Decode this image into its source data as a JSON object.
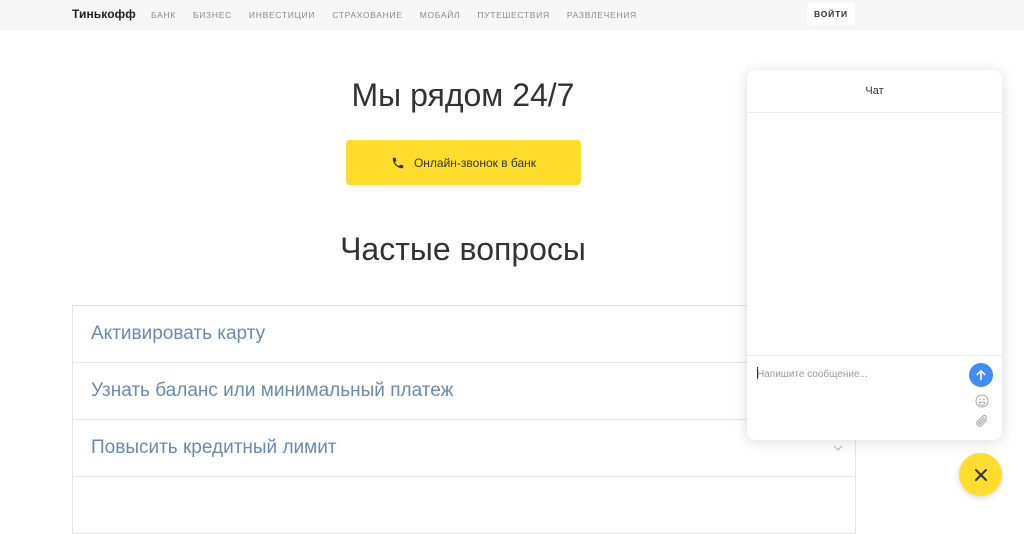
{
  "header": {
    "logo": "Тинькофф",
    "nav": [
      "БАНК",
      "БИЗНЕС",
      "ИНВЕСТИЦИИ",
      "СТРАХОВАНИЕ",
      "МОБАЙЛ",
      "ПУТЕШЕСТВИЯ",
      "РАЗВЛЕЧЕНИЯ"
    ],
    "login_label": "ВОЙТИ"
  },
  "main": {
    "title": "Мы рядом 24/7",
    "call_button_label": "Онлайн-звонок в банк",
    "faq_title": "Частые вопросы",
    "faq_items": [
      "Активировать карту",
      "Узнать баланс или минимальный платеж",
      "Повысить кредитный лимит",
      ""
    ]
  },
  "chat": {
    "title": "Чат",
    "input_placeholder": "Напишите сообщение..."
  },
  "colors": {
    "accent_yellow": "#ffdd2d",
    "send_blue": "#428bf9",
    "faq_text": "#6c8aab"
  }
}
